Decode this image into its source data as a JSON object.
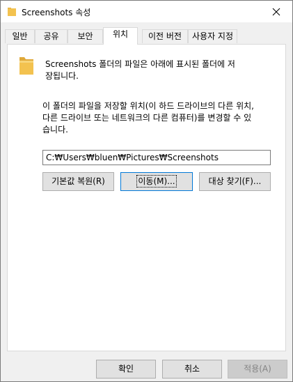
{
  "window": {
    "title": "Screenshots 속성",
    "close_icon": "close-icon"
  },
  "tabs": [
    {
      "label": "일반",
      "active": false
    },
    {
      "label": "공유",
      "active": false
    },
    {
      "label": "보안",
      "active": false
    },
    {
      "label": "위치",
      "active": true
    },
    {
      "label": "이전 버전",
      "active": false
    },
    {
      "label": "사용자 지정",
      "active": false
    }
  ],
  "location": {
    "description": "Screenshots 폴더의 파일은 아래에 표시된 폴더에 저장됩니다.",
    "description_line1": "Screenshots 폴더의 파일은 아래에 표시된 폴더에 저",
    "description_line2": "장됩니다.",
    "explain_line1": "이 폴더의 파일을 저장할 위치(이 하드 드라이브의 다른 위치,",
    "explain_line2": "다른 드라이브 또는 네트워크의 다른 컴퓨터)를 변경할 수 있",
    "explain_line3": "습니다.",
    "path_value": "C:₩Users₩bluen₩Pictures₩Screenshots",
    "restore_default_label": "기본값 복원(R)",
    "move_label": "이동(M)...",
    "find_target_label": "대상 찾기(F)..."
  },
  "footer": {
    "ok_label": "확인",
    "cancel_label": "취소",
    "apply_label": "적용(A)"
  },
  "colors": {
    "folder": "#f3c24f",
    "focus_border": "#0078d7",
    "window_bg": "#f0f0f0"
  }
}
